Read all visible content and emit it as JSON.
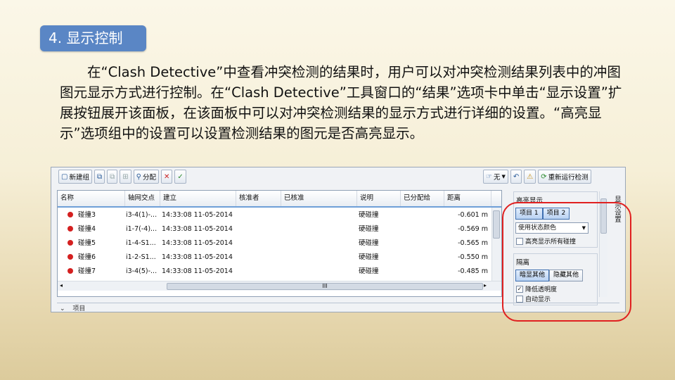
{
  "slide": {
    "title": "4. 显示控制",
    "paragraph": "在“Clash Detective”中查看冲突检测的结果时，用户可以对冲突检测结果列表中的冲图图元显示方式进行控制。在“Clash Detective”工具窗口的“结果”选项卡中单击“显示设置”扩展按钮展开该面板，在该面板中可以对冲突检测结果的显示方式进行详细的设置。“高亮显示”选项组中的设置可以设置检测结果的图元是否高亮显示。"
  },
  "toolbar": {
    "new_group": "新建组",
    "assign": "分配",
    "none_dropdown": "无",
    "rerun": "重新运行检测"
  },
  "table": {
    "columns": [
      "名称",
      "轴网交点",
      "建立",
      "核准者",
      "已核准",
      "说明",
      "已分配给",
      "距离"
    ],
    "rows": [
      {
        "name": "碰撞3",
        "grid": "i3-4(1)-...",
        "created": "14:33:08 11-05-2014",
        "desc": "硬碰撞",
        "distance": "-0.601 m"
      },
      {
        "name": "碰撞4",
        "grid": "i1-7(-4)...",
        "created": "14:33:08 11-05-2014",
        "desc": "硬碰撞",
        "distance": "-0.569 m"
      },
      {
        "name": "碰撞5",
        "grid": "i1-4-S1...",
        "created": "14:33:08 11-05-2014",
        "desc": "硬碰撞",
        "distance": "-0.565 m"
      },
      {
        "name": "碰撞6",
        "grid": "i1-2-S1...",
        "created": "14:33:08 11-05-2014",
        "desc": "硬碰撞",
        "distance": "-0.550 m"
      },
      {
        "name": "碰撞7",
        "grid": "i3-4(5)-...",
        "created": "14:33:08 11-05-2014",
        "desc": "硬碰撞",
        "distance": "-0.485 m"
      }
    ],
    "scroll_grip": "III"
  },
  "bottom_label": "项目",
  "panel": {
    "highlight_title": "高亮显示",
    "item1": "项目 1",
    "item2": "项目 2",
    "color_mode": "使用状态颜色",
    "highlight_all": "高亮显示所有碰撞",
    "isolate_title": "隔离",
    "dim_others": "暗显其他",
    "hide_others": "隐藏其他",
    "reduce_transparency": "降低透明度",
    "auto_show": "自动显示",
    "side_tab": "显示设置"
  }
}
